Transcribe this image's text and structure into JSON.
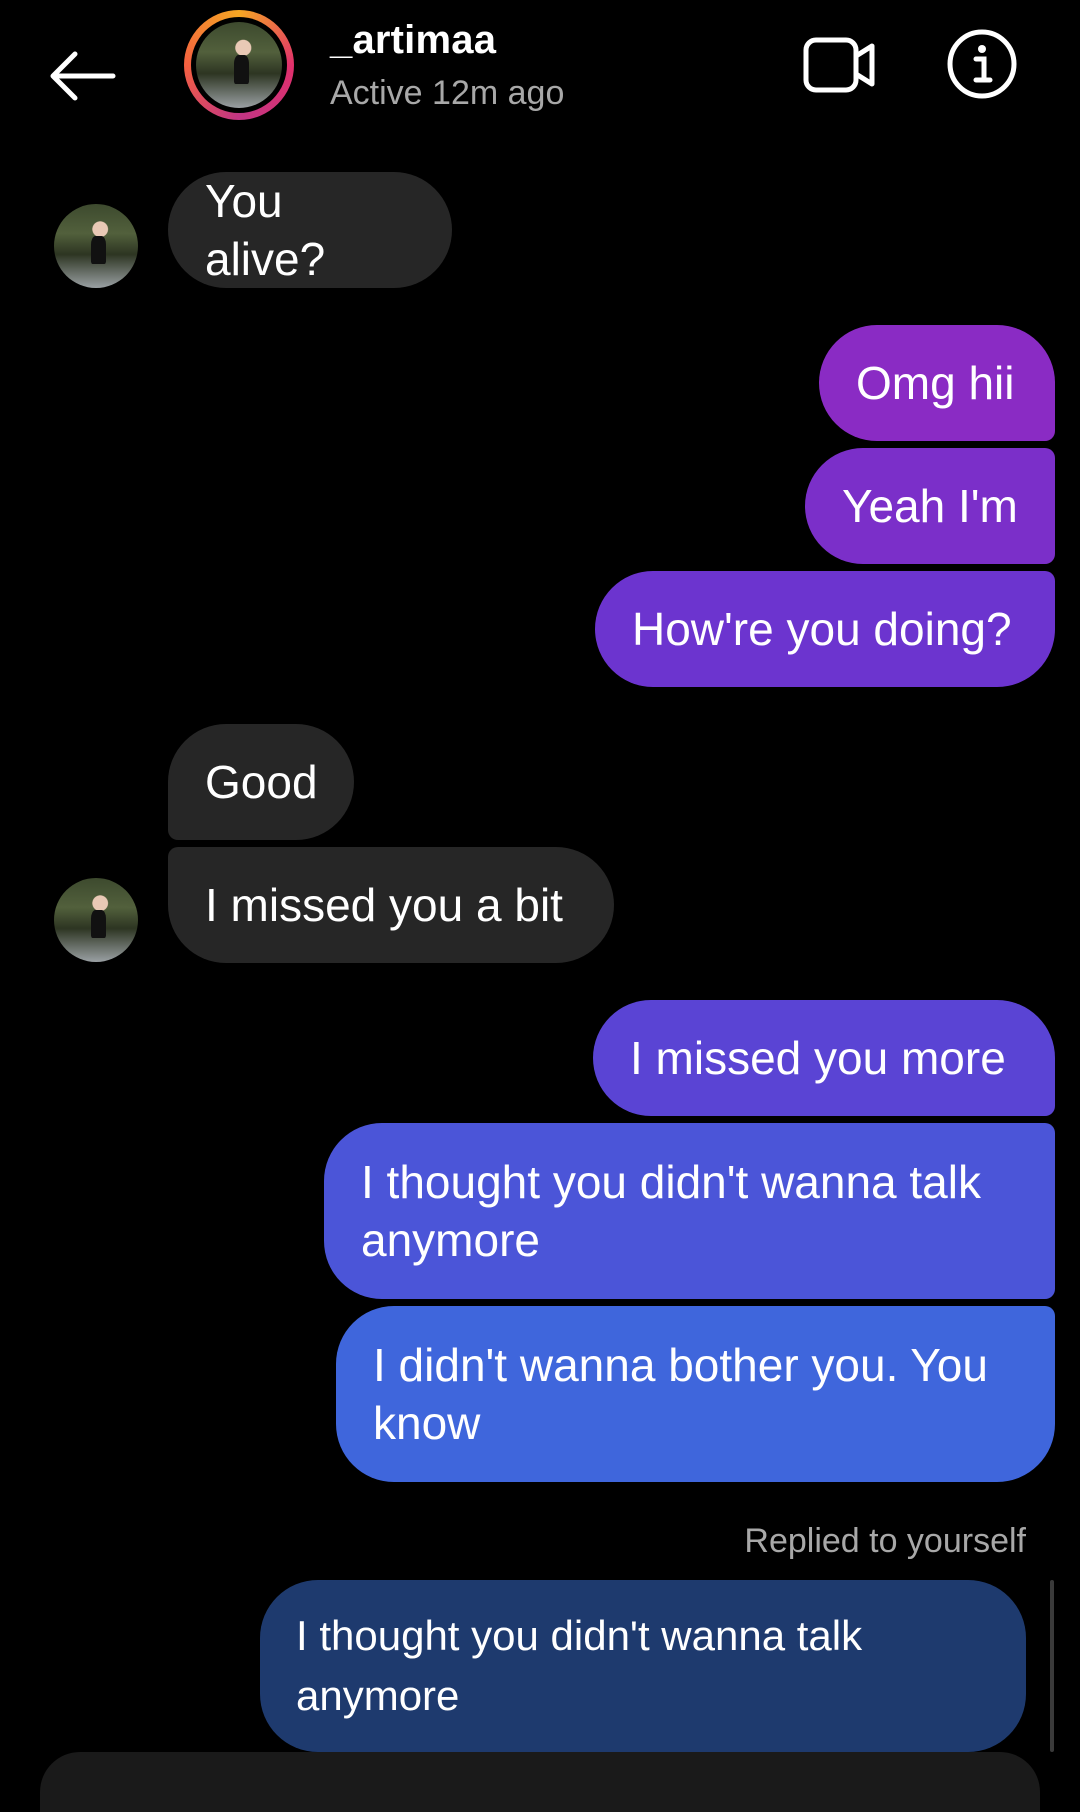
{
  "header": {
    "username": "_artimaa",
    "status": "Active 12m ago",
    "back_icon": "arrow-left-icon",
    "video_icon": "video-camera-icon",
    "info_icon": "info-icon"
  },
  "messages": [
    {
      "from": "them",
      "text": "You alive?"
    },
    {
      "from": "me",
      "text": "Omg hii"
    },
    {
      "from": "me",
      "text": "Yeah I'm"
    },
    {
      "from": "me",
      "text": "How're you doing?"
    },
    {
      "from": "them",
      "text": "Good"
    },
    {
      "from": "them",
      "text": "I missed you a bit"
    },
    {
      "from": "me",
      "text": "I missed you more"
    },
    {
      "from": "me",
      "text": "I thought you didn't wanna talk anymore"
    },
    {
      "from": "me",
      "text": "I didn't wanna bother you. You know"
    }
  ],
  "reply": {
    "label": "Replied to yourself",
    "quoted_text": "I thought you didn't wanna talk anymore"
  },
  "colors": {
    "background": "#000000",
    "received_bubble": "#262626",
    "sent_gradient_top": "#8a2bc4",
    "sent_gradient_bottom": "#3d6fdc",
    "quoted_bubble": "#1e3a6e",
    "secondary_text": "#a8a8a8"
  }
}
